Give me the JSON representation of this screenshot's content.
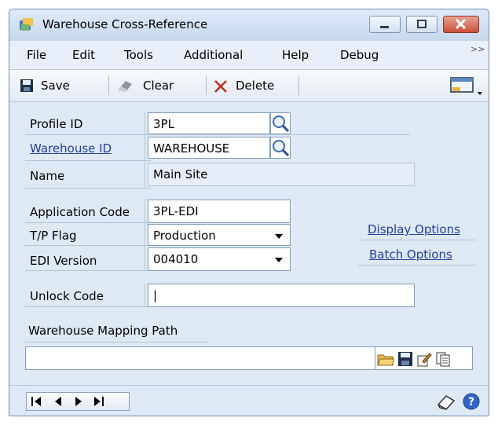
{
  "window": {
    "title": "Warehouse Cross-Reference"
  },
  "menu": [
    "File",
    "Edit",
    "Tools",
    "Additional",
    "Help",
    "Debug"
  ],
  "toolbar": {
    "save": "Save",
    "clear": "Clear",
    "delete": "Delete"
  },
  "form": {
    "profile_id": {
      "label": "Profile ID",
      "value": "3PL"
    },
    "warehouse_id": {
      "label": "Warehouse ID",
      "value": "WAREHOUSE"
    },
    "name": {
      "label": "Name",
      "value": "Main Site"
    },
    "application_code": {
      "label": "Application Code",
      "value": "3PL-EDI"
    },
    "tp_flag": {
      "label": "T/P Flag",
      "value": "Production"
    },
    "edi_version": {
      "label": "EDI Version",
      "value": "004010"
    },
    "unlock_code": {
      "label": "Unlock Code",
      "value": "|"
    },
    "mapping_path": {
      "label": "Warehouse Mapping Path",
      "value": ""
    }
  },
  "links": {
    "display_options": "Display Options",
    "batch_options": "Batch Options"
  },
  "colors": {
    "link": "#1f3fa0",
    "window_bg": "#dfe9f5"
  },
  "icons": [
    "save-icon",
    "eraser-icon",
    "delete-x-icon",
    "open-folder-icon",
    "floppy-icon",
    "edit-icon",
    "copy-icon",
    "note-icon",
    "help-icon"
  ]
}
